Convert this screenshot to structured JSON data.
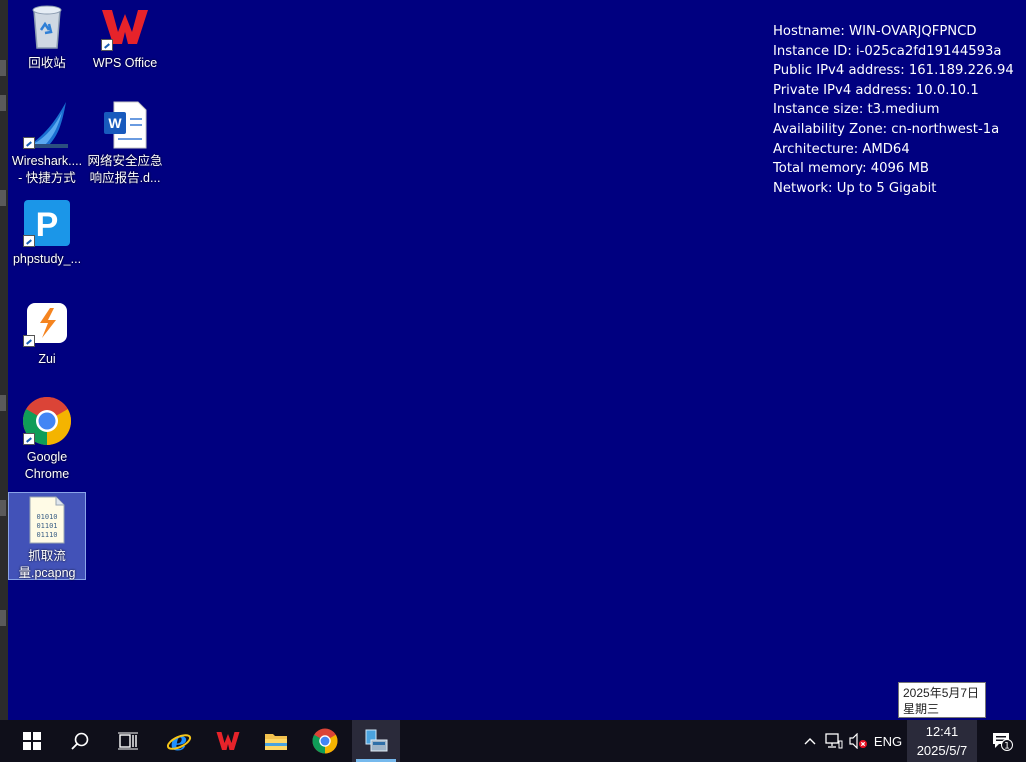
{
  "desktop": {
    "icons": [
      {
        "label": "回收站"
      },
      {
        "label": "WPS Office"
      },
      {
        "label": "Wireshark.... - 快捷方式"
      },
      {
        "label": "网络安全应急响应报告.d..."
      },
      {
        "label": "phpstudy_..."
      },
      {
        "label": "Zui"
      },
      {
        "label": "Google Chrome"
      },
      {
        "label": "抓取流量.pcapng",
        "selected": true
      }
    ]
  },
  "info_panel": {
    "lines": [
      "Hostname: WIN-OVARJQFPNCD",
      "Instance ID: i-025ca2fd19144593a",
      "Public IPv4 address: 161.189.226.94",
      "Private IPv4 address: 10.0.10.1",
      "Instance size: t3.medium",
      "Availability Zone: cn-northwest-1a",
      "Architecture: AMD64",
      "Total memory: 4096 MB",
      "Network: Up to 5 Gigabit"
    ]
  },
  "tooltip": {
    "date_long": "2025年5月7日",
    "weekday": "星期三"
  },
  "taskbar": {
    "apps": [
      {
        "name": "start"
      },
      {
        "name": "search"
      },
      {
        "name": "task-view"
      },
      {
        "name": "internet-explorer"
      },
      {
        "name": "wps"
      },
      {
        "name": "file-explorer"
      },
      {
        "name": "chrome"
      },
      {
        "name": "remote-desktop",
        "active": true
      }
    ],
    "language": "ENG",
    "time": "12:41",
    "date": "2025/5/7",
    "notification_count": "1"
  },
  "colors": {
    "desktop_bg": "#000080",
    "taskbar_bg": "#0f0f1a",
    "accent": "#76b9ed"
  }
}
